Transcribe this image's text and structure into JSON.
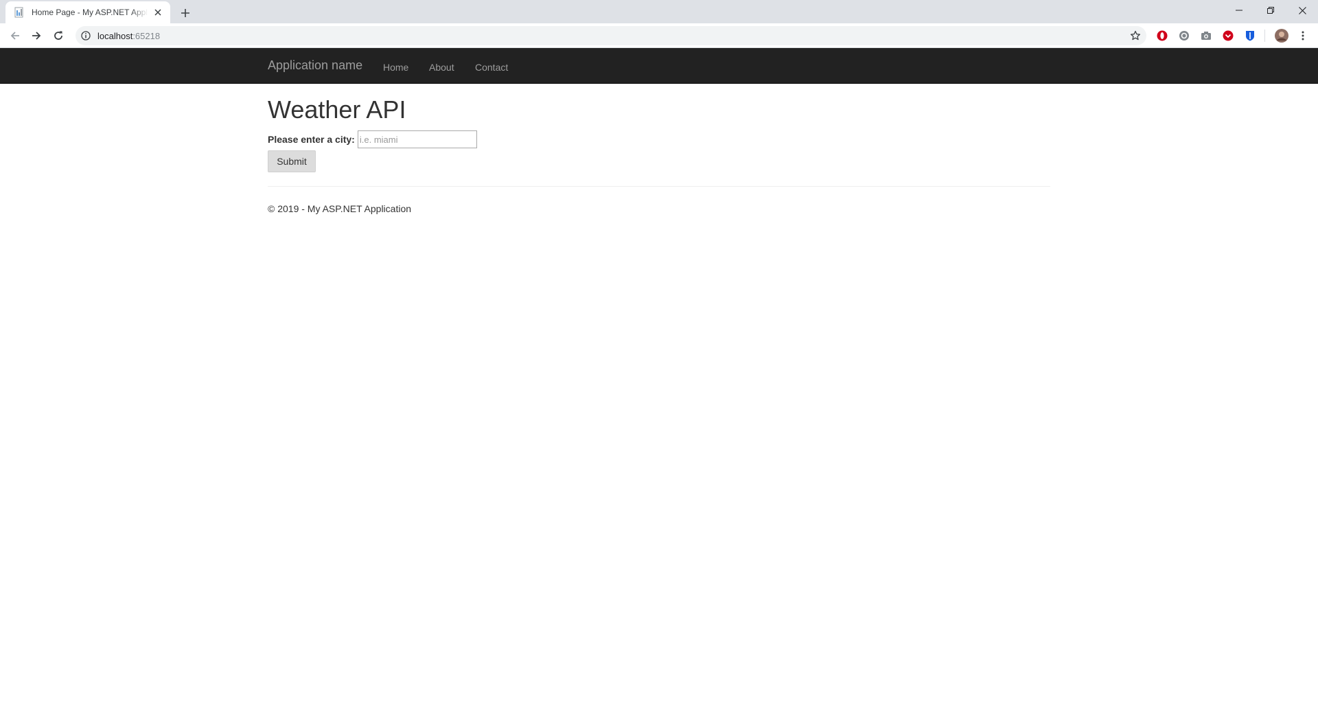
{
  "browser": {
    "tab_title": "Home Page - My ASP.NET Application",
    "url_host": "localhost",
    "url_port": ":65218",
    "icons": {
      "favicon": "page-icon",
      "tab_close": "close-icon",
      "new_tab": "plus-icon",
      "minimize": "minimize-icon",
      "restore": "restore-icon",
      "close_window": "close-icon",
      "back": "back-arrow-icon",
      "forward": "forward-arrow-icon",
      "reload": "reload-icon",
      "site_info": "info-icon",
      "bookmark": "star-icon",
      "extensions": [
        "opera-icon",
        "ublock-icon",
        "camera-icon",
        "pocket-icon",
        "bitwarden-icon"
      ],
      "profile": "avatar-icon",
      "menu": "more-vert-icon"
    },
    "colors": {
      "tabstrip": "#dee1e6",
      "extension_red": "#d0021b",
      "extension_blue": "#175ddc"
    }
  },
  "navbar": {
    "brand": "Application name",
    "links": [
      "Home",
      "About",
      "Contact"
    ],
    "background": "#222222"
  },
  "main": {
    "title": "Weather API",
    "city_label": "Please enter a city:",
    "city_placeholder": "i.e. miami",
    "city_value": "",
    "submit_label": "Submit"
  },
  "footer": {
    "text": "© 2019 - My ASP.NET Application"
  }
}
